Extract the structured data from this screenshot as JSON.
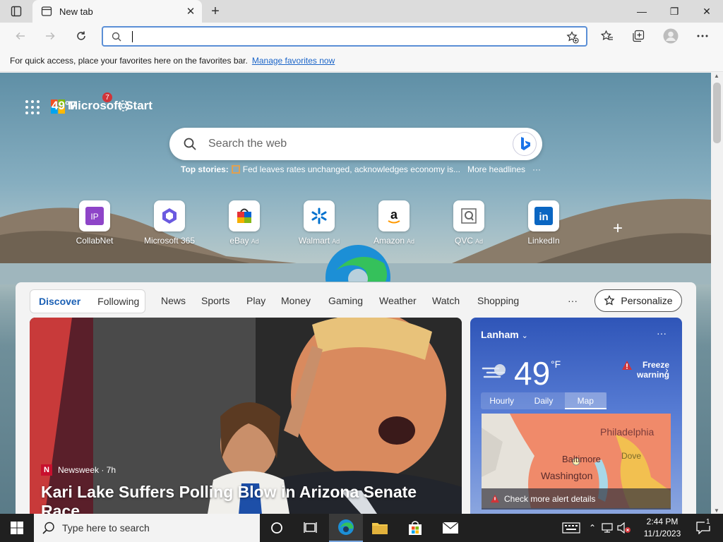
{
  "browser": {
    "tab_title": "New tab",
    "window_controls": {
      "minimize": "—",
      "maximize": "❐",
      "close": "✕"
    },
    "address_placeholder": ""
  },
  "favorites_bar": {
    "text": "For quick access, place your favorites here on the favorites bar.",
    "link": "Manage favorites now"
  },
  "newtab": {
    "brand": "Microsoft Start",
    "temperature": "49°F",
    "notification_count": "7",
    "search_placeholder": "Search the web",
    "top_stories_label": "Top stories:",
    "top_story": "Fed leaves rates unchanged, acknowledges economy is...",
    "more_headlines": "More headlines",
    "more_icon": "···",
    "quick_links": [
      {
        "label": "CollabNet",
        "ad": "",
        "icon": "collabnet-icon"
      },
      {
        "label": "Microsoft 365",
        "ad": "",
        "icon": "microsoft365-icon"
      },
      {
        "label": "eBay",
        "ad": "Ad",
        "icon": "ebay-icon"
      },
      {
        "label": "Walmart",
        "ad": "Ad",
        "icon": "walmart-icon"
      },
      {
        "label": "Amazon",
        "ad": "Ad",
        "icon": "amazon-icon"
      },
      {
        "label": "QVC",
        "ad": "Ad",
        "icon": "qvc-icon"
      },
      {
        "label": "LinkedIn",
        "ad": "",
        "icon": "linkedin-icon"
      }
    ]
  },
  "feed": {
    "discover": "Discover",
    "following": "Following",
    "nav": [
      "News",
      "Sports",
      "Play",
      "Money",
      "Gaming",
      "Weather",
      "Watch",
      "Shopping"
    ],
    "more": "···",
    "personalize": "Personalize",
    "hero": {
      "source": "Newsweek · 7h",
      "title": "Kari Lake Suffers Polling Blow in Arizona Senate Race"
    },
    "weather": {
      "location": "Lanham",
      "temp": "49",
      "unit": "°F",
      "alert": "Freeze warning",
      "tabs": [
        "Hourly",
        "Daily",
        "Map"
      ],
      "map_labels": [
        "Philadelphia",
        "Baltimore",
        "Dove",
        "Washington"
      ],
      "check_alert": "Check more alert details"
    }
  },
  "taskbar": {
    "search_placeholder": "Type here to search",
    "time": "2:44 PM",
    "date": "11/1/2023",
    "notification_count": "1"
  }
}
